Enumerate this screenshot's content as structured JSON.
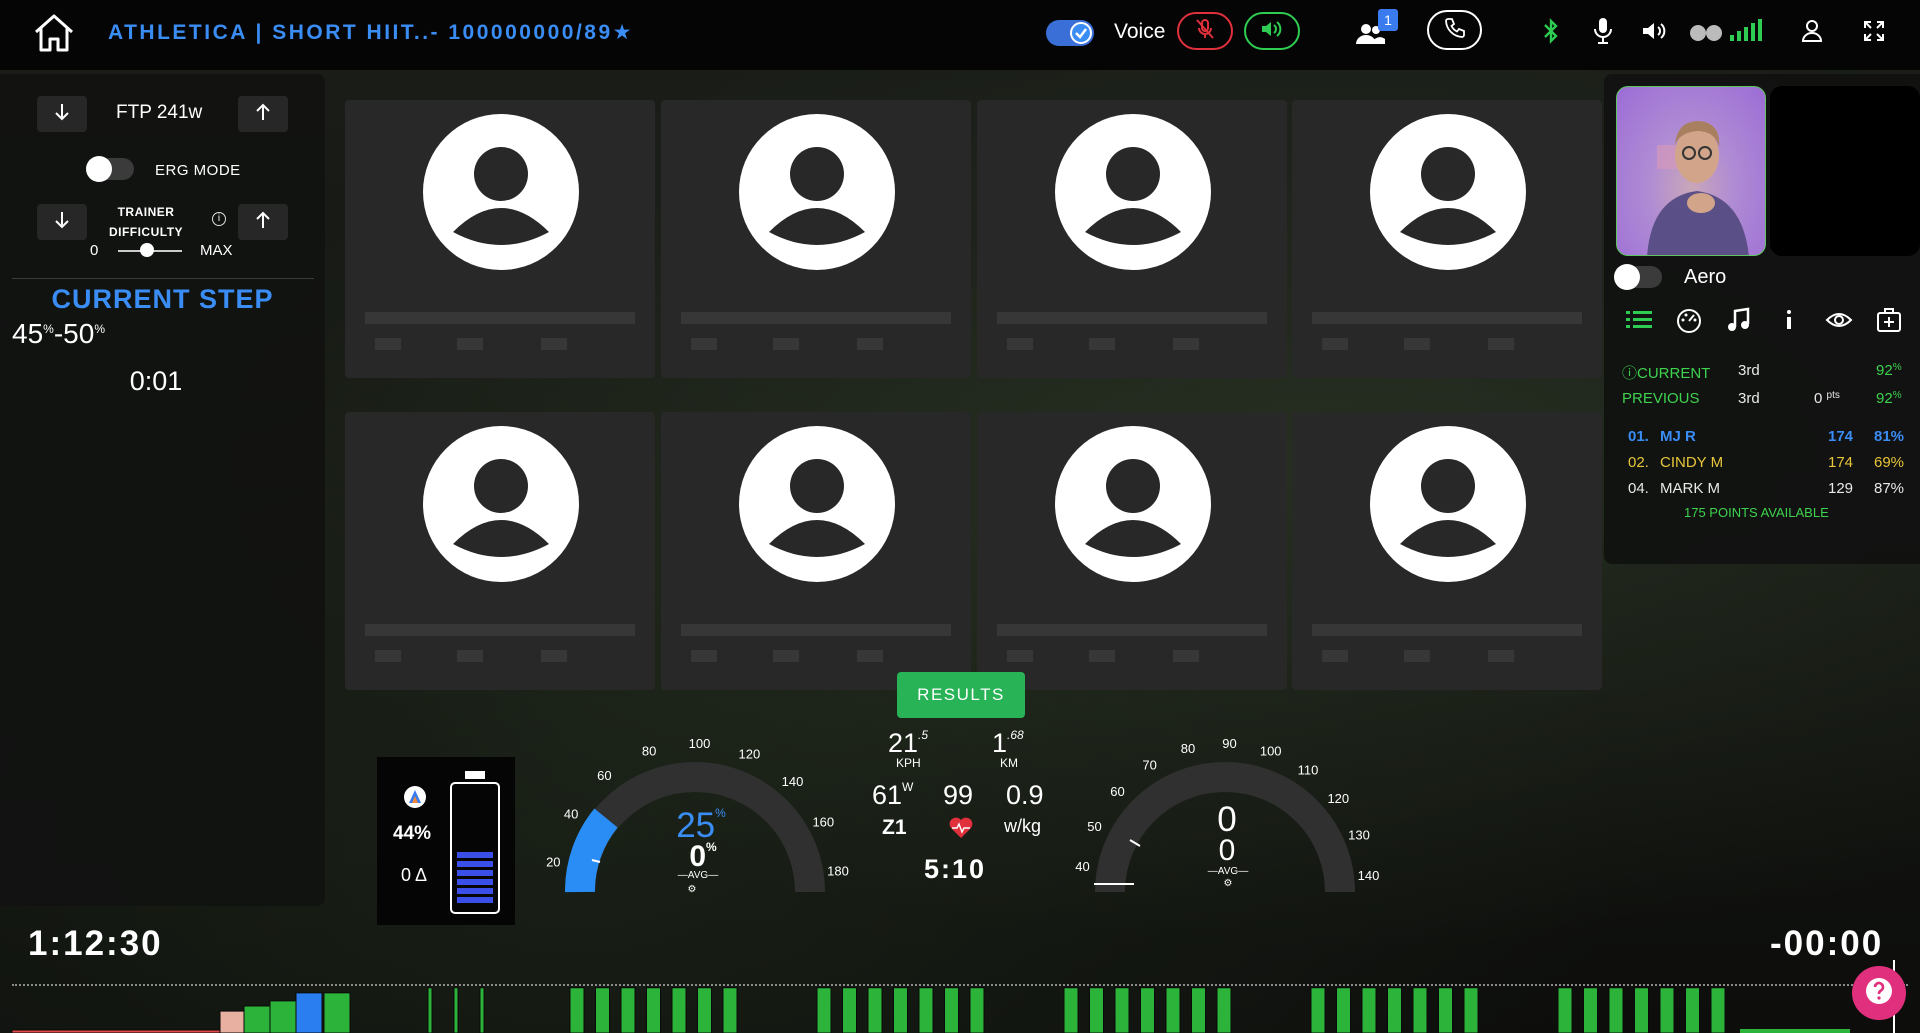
{
  "header": {
    "title": "ATHLETICA | SHORT HIIT..- 100000000/89",
    "voice_label": "Voice",
    "participants_badge": "1"
  },
  "left_panel": {
    "ftp_label": "FTP 241w",
    "erg_mode_label": "ERG MODE",
    "trainer_difficulty_label": "TRAINER DIFFICULTY",
    "info_glyph": "i",
    "slider_min": "0",
    "slider_max": "MAX",
    "slider_value": 0.45,
    "current_step_label": "CURRENT STEP",
    "range_low": "45",
    "range_high": "50",
    "range_unit": "%",
    "range_sep": "-",
    "step_time": "0:01"
  },
  "tiles": [
    {
      "name": "participant-1"
    },
    {
      "name": "participant-2"
    },
    {
      "name": "participant-3"
    },
    {
      "name": "participant-4"
    },
    {
      "name": "participant-5"
    },
    {
      "name": "participant-6"
    },
    {
      "name": "participant-7"
    },
    {
      "name": "participant-8"
    }
  ],
  "right_panel": {
    "aero_label": "Aero",
    "current_label": "CURRENT",
    "current_place": "3rd",
    "current_pct": "92",
    "previous_label": "PREVIOUS",
    "previous_place": "3rd",
    "previous_points": "0",
    "points_unit": "pts",
    "previous_pct": "92",
    "pct_unit": "%",
    "leaderboard": [
      {
        "rank": "01.",
        "name": "MJ R",
        "points": "174",
        "pct": "81%"
      },
      {
        "rank": "02.",
        "name": "CINDY M",
        "points": "174",
        "pct": "69%"
      },
      {
        "rank": "04.",
        "name": "MARK M",
        "points": "129",
        "pct": "87%"
      }
    ],
    "points_available": "175 POINTS AVAILABLE"
  },
  "results_label": "RESULTS",
  "battery": {
    "percent": "44%",
    "delta": "0 Δ",
    "level": 0.44
  },
  "left_gauge": {
    "ticks": [
      "20",
      "40",
      "60",
      "80",
      "100",
      "120",
      "140",
      "160",
      "180"
    ],
    "value": "25",
    "value_unit": "%",
    "avg_value": "0",
    "avg_unit": "%",
    "avg_label": "AVG"
  },
  "center_stats": {
    "speed": "21",
    "speed_dec": ".5",
    "speed_unit": "KPH",
    "distance": "1",
    "distance_dec": ".68",
    "distance_unit": "KM",
    "power": "61",
    "power_unit": "W",
    "zone": "Z1",
    "heart_rate": "99",
    "wkg": "0.9",
    "wkg_unit": "w/kg",
    "interval_time": "5:10"
  },
  "right_gauge": {
    "ticks": [
      "40",
      "50",
      "60",
      "70",
      "80",
      "90",
      "100",
      "110",
      "120",
      "130",
      "140"
    ],
    "value": "0",
    "avg_value": "0",
    "avg_label": "AVG"
  },
  "timers": {
    "elapsed": "1:12:30",
    "remaining": "-00:00"
  },
  "workout_profile": {
    "warmup": [
      0.02,
      0.04,
      0.07,
      0.12,
      0.16,
      0.2,
      0.24,
      0.3,
      0.37,
      0.44,
      0.55
    ],
    "interval_height": 0.62
  },
  "colors": {
    "accent": "#3a8df5",
    "green": "#2ecc52",
    "red": "#e0303c",
    "pink": "#e02f7c"
  }
}
